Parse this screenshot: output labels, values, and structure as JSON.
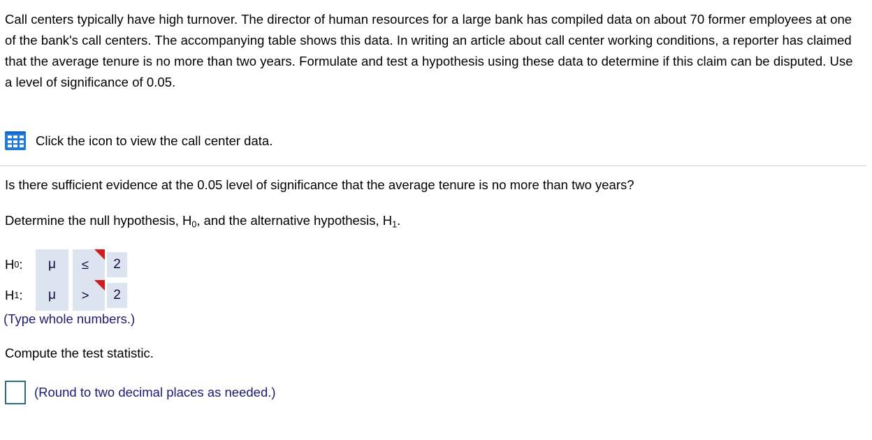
{
  "problem": {
    "statement": "Call centers typically have high turnover. The director of human resources for a large bank has compiled data on about 70 former employees at one of the bank's call centers. The accompanying table shows this data. In writing an article about call center working conditions, a reporter has claimed that the average tenure is no more than two years. Formulate and test a hypothesis using these data to determine if this claim can be disputed. Use a level of significance of 0.05."
  },
  "data_link": {
    "icon_name": "table-grid-icon",
    "icon_color": "#1f7ae0",
    "label": "Click the icon to view the call center data."
  },
  "questions": {
    "sufficient_evidence": "Is there sufficient evidence at the 0.05 level of significance that the average tenure is no more than two years?",
    "determine_hypotheses_pre": "Determine the null hypothesis, H",
    "determine_hypotheses_sub0": "0",
    "determine_hypotheses_mid": ", and the alternative hypothesis, H",
    "determine_hypotheses_sub1": "1",
    "determine_hypotheses_post": ".",
    "compute_test_statistic": "Compute the test statistic."
  },
  "hypotheses": {
    "rows": [
      {
        "label_base": "H",
        "label_sub": "0",
        "label_colon": ":",
        "parameter": "μ",
        "operator": "≤",
        "value": "2"
      },
      {
        "label_base": "H",
        "label_sub": "1",
        "label_colon": ":",
        "parameter": "μ",
        "operator": ">",
        "value": "2"
      }
    ],
    "hint": "(Type whole numbers.)",
    "answer_fill_color": "#dbe4ef",
    "flag_color": "#d21b1b"
  },
  "test_statistic": {
    "input_value": "",
    "input_placeholder": "",
    "hint": "(Round to two decimal places as needed.)",
    "input_border_color": "#2c6b80"
  }
}
